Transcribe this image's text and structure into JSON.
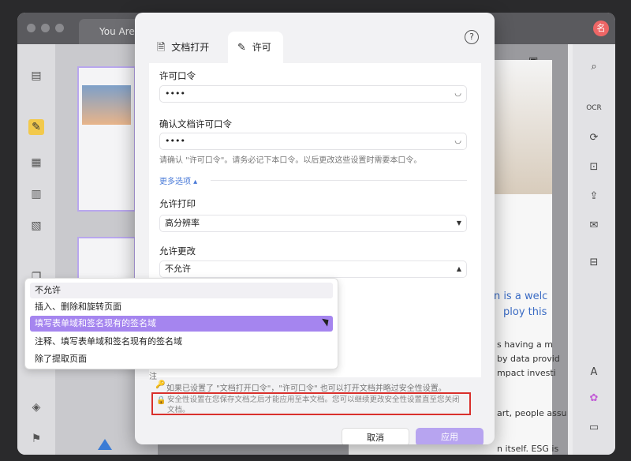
{
  "window": {
    "tab_title": "You Are",
    "avatar_initial": "名"
  },
  "background_page": {
    "lines": [
      "on is a welc",
      "ploy this",
      "s having a m",
      "by data provid",
      "mpact investi",
      "art, people assu",
      "n itself. ESG is"
    ]
  },
  "dialog": {
    "tabs": [
      {
        "label": "文档打开",
        "icon": "lock-doc-icon"
      },
      {
        "label": "许可",
        "icon": "edit-icon"
      }
    ],
    "help_symbol": "?",
    "permission_password": {
      "label": "许可口令",
      "value": "••••"
    },
    "confirm_password": {
      "label": "确认文档许可口令",
      "value": "••••"
    },
    "password_hint": "请确认 \"许可口令\"。请务必记下本口令。以后更改这些设置时需要本口令。",
    "more_options": "更多选项 ▴",
    "allow_print": {
      "label": "允许打印",
      "value": "高分辨率"
    },
    "allow_changes": {
      "label": "允许更改",
      "value": "不允许"
    },
    "dropdown_options": [
      "不允许",
      "插入、删除和旋转页面",
      "填写表单域和签名现有的签名域",
      "注释、填写表单域和签名现有的签名域",
      "除了提取页面"
    ],
    "hidden_note_prefix": "注",
    "note_text": "如果已设置了 \"文档打开口令\"，\"许可口令\" 也可以打开文档并略过安全性设置。",
    "warning_text": "安全性设置在您保存文档之后才能应用至本文档。您可以继续更改安全性设置直至您关闭文档。",
    "cancel_label": "取消",
    "apply_label": "应用"
  },
  "colors": {
    "accent": "#a585ef",
    "highlight_border": "#d9302c",
    "link": "#4b7bd8"
  }
}
